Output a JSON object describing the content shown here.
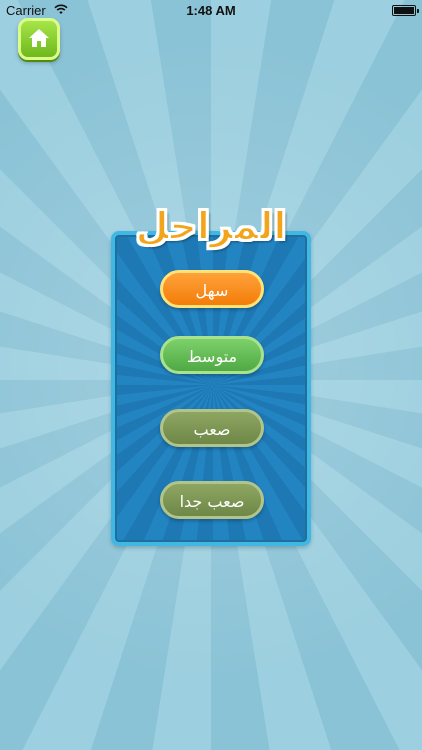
{
  "status_bar": {
    "carrier": "Carrier",
    "time": "1:48 AM"
  },
  "panel": {
    "title": "المراحل"
  },
  "levels": {
    "easy": "سهل",
    "medium": "متوسط",
    "hard": "صعب",
    "very_hard": "صعب جدا"
  },
  "colors": {
    "background": "#8fc6d8",
    "panel": "#2384c2",
    "title": "#f2a51b",
    "easy_button": "#f37d09",
    "medium_button": "#4fa944",
    "hard_button": "#6f8747"
  },
  "icons": {
    "home": "home-icon",
    "wifi": "wifi-icon",
    "battery": "battery-icon"
  }
}
